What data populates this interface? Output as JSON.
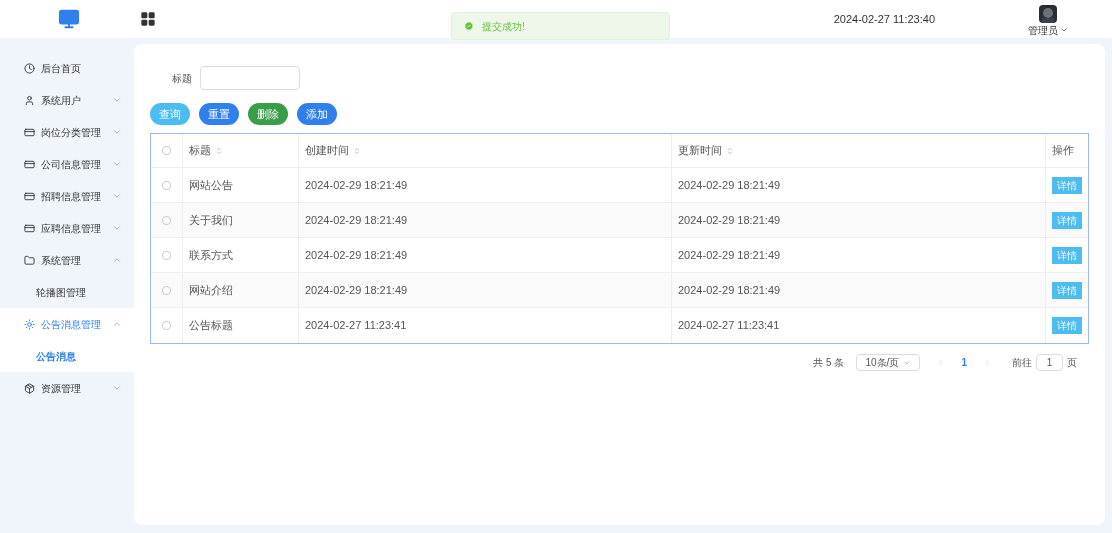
{
  "header": {
    "datetime": "2024-02-27 11:23:40",
    "user": "管理员"
  },
  "toast": {
    "message": "提交成功!"
  },
  "sidebar": {
    "items": [
      {
        "label": "后台首页",
        "has_arrow": false,
        "selected": false
      },
      {
        "label": "系统用户",
        "expanded": false,
        "has_arrow": true,
        "selected": false
      },
      {
        "label": "岗位分类管理",
        "expanded": false,
        "has_arrow": true,
        "selected": false
      },
      {
        "label": "公司信息管理",
        "expanded": false,
        "has_arrow": true,
        "selected": false
      },
      {
        "label": "招聘信息管理",
        "expanded": false,
        "has_arrow": true,
        "selected": false
      },
      {
        "label": "应聘信息管理",
        "expanded": false,
        "has_arrow": true,
        "selected": false
      },
      {
        "label": "系统管理",
        "expanded": true,
        "has_arrow": true,
        "selected": false,
        "children": [
          {
            "label": "轮播图管理",
            "selected": false
          }
        ]
      },
      {
        "label": "公告消息管理",
        "expanded": true,
        "has_arrow": true,
        "selected": true,
        "children": [
          {
            "label": "公告消息",
            "selected": true
          }
        ]
      },
      {
        "label": "资源管理",
        "expanded": false,
        "has_arrow": true,
        "selected": false
      }
    ]
  },
  "search": {
    "label": "标题"
  },
  "buttons": [
    {
      "label": "查询",
      "color": "#4dbcf1"
    },
    {
      "label": "重置",
      "color": "#2f80ed"
    },
    {
      "label": "删除",
      "color": "#3a9d4a"
    },
    {
      "label": "添加",
      "color": "#2f80ed"
    }
  ],
  "table": {
    "all_checked": false,
    "columns": [
      {
        "label": "标题",
        "sortable": true
      },
      {
        "label": "创建时间",
        "sortable": true
      },
      {
        "label": "更新时间",
        "sortable": true
      },
      {
        "label": "操作",
        "sortable": false
      }
    ],
    "rows": [
      {
        "checked": false,
        "title": "网站公告",
        "created": "2024-02-29 18:21:49",
        "updated": "2024-02-29 18:21:49",
        "action": "详情"
      },
      {
        "checked": false,
        "title": "关于我们",
        "created": "2024-02-29 18:21:49",
        "updated": "2024-02-29 18:21:49",
        "action": "详情"
      },
      {
        "checked": false,
        "title": "联系方式",
        "created": "2024-02-29 18:21:49",
        "updated": "2024-02-29 18:21:49",
        "action": "详情"
      },
      {
        "checked": false,
        "title": "网站介绍",
        "created": "2024-02-29 18:21:49",
        "updated": "2024-02-29 18:21:49",
        "action": "详情"
      },
      {
        "checked": false,
        "title": "公告标题",
        "created": "2024-02-27 11:23:41",
        "updated": "2024-02-27 11:23:41",
        "action": "详情"
      }
    ]
  },
  "pagination": {
    "total": "共 5 条",
    "page_size": "10条/页",
    "pages": [
      {
        "label": "1",
        "selected": true
      }
    ],
    "goto_label": "前往",
    "goto_value": "1",
    "goto_suffix": "页"
  }
}
